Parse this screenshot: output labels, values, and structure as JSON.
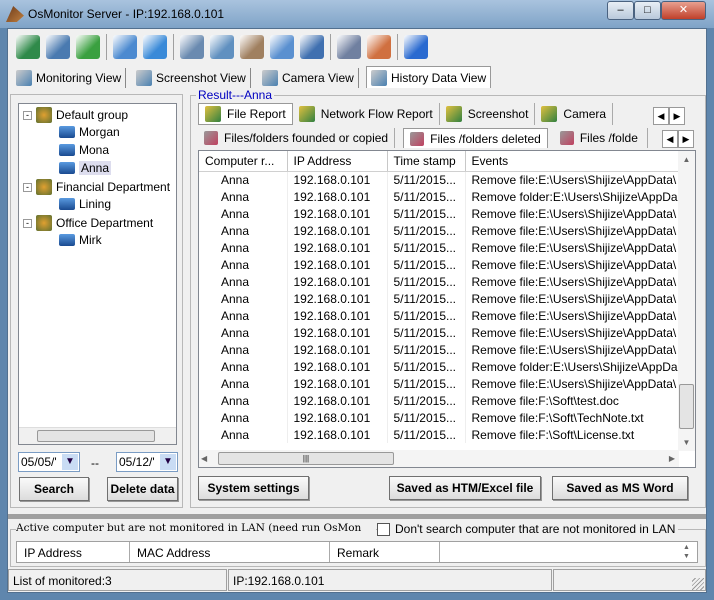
{
  "window": {
    "title": "OsMonitor Server -  IP:192.168.0.101",
    "minimize": "–",
    "maximize": "□",
    "close": "✕"
  },
  "toolbar": {
    "icons": [
      "windows-icon",
      "monitor-settings-icon",
      "users-icon",
      "app-control-icon",
      "usb-icon",
      "remote-desktop-icon",
      "mail-icon",
      "document-search-icon",
      "network-windows-icon",
      "disk-icon",
      "notebook-icon",
      "user-report-icon",
      "help-icon"
    ]
  },
  "main_tabs": [
    {
      "label": "Monitoring View"
    },
    {
      "label": "Screenshot View"
    },
    {
      "label": "Camera View"
    },
    {
      "label": "History Data View",
      "active": true
    }
  ],
  "tree": {
    "groups": [
      {
        "label": "Default group",
        "members": [
          "Morgan",
          "Mona",
          "Anna"
        ]
      },
      {
        "label": "Financial Department",
        "members": [
          "Lining"
        ]
      },
      {
        "label": "Office Department",
        "members": [
          "Mirk"
        ]
      }
    ],
    "selected": "Anna"
  },
  "date_range": {
    "from": "05/05/'",
    "separator": "--",
    "to": "05/12/'"
  },
  "left_buttons": {
    "search": "Search",
    "delete": "Delete data"
  },
  "result": {
    "legend": "Result---Anna",
    "report_tabs": [
      {
        "label": "File Report",
        "active": true
      },
      {
        "label": "Network Flow Report"
      },
      {
        "label": "Screenshot"
      },
      {
        "label": "Camera"
      }
    ],
    "sub_tabs": [
      {
        "label": "Files/folders founded or copied"
      },
      {
        "label": "Files /folders deleted",
        "active": true
      },
      {
        "label": "Files /folde"
      }
    ],
    "columns": [
      "Computer r...",
      "IP Address",
      "Time stamp",
      "Events"
    ],
    "rows": [
      [
        "Anna",
        "192.168.0.101",
        "5/11/2015...",
        "Remove file:E:\\Users\\Shijize\\AppData\\"
      ],
      [
        "Anna",
        "192.168.0.101",
        "5/11/2015...",
        "Remove folder:E:\\Users\\Shijize\\AppDa"
      ],
      [
        "Anna",
        "192.168.0.101",
        "5/11/2015...",
        "Remove file:E:\\Users\\Shijize\\AppData\\"
      ],
      [
        "Anna",
        "192.168.0.101",
        "5/11/2015...",
        "Remove file:E:\\Users\\Shijize\\AppData\\"
      ],
      [
        "Anna",
        "192.168.0.101",
        "5/11/2015...",
        "Remove file:E:\\Users\\Shijize\\AppData\\"
      ],
      [
        "Anna",
        "192.168.0.101",
        "5/11/2015...",
        "Remove file:E:\\Users\\Shijize\\AppData\\"
      ],
      [
        "Anna",
        "192.168.0.101",
        "5/11/2015...",
        "Remove file:E:\\Users\\Shijize\\AppData\\"
      ],
      [
        "Anna",
        "192.168.0.101",
        "5/11/2015...",
        "Remove file:E:\\Users\\Shijize\\AppData\\"
      ],
      [
        "Anna",
        "192.168.0.101",
        "5/11/2015...",
        "Remove file:E:\\Users\\Shijize\\AppData\\"
      ],
      [
        "Anna",
        "192.168.0.101",
        "5/11/2015...",
        "Remove file:E:\\Users\\Shijize\\AppData\\"
      ],
      [
        "Anna",
        "192.168.0.101",
        "5/11/2015...",
        "Remove file:E:\\Users\\Shijize\\AppData\\"
      ],
      [
        "Anna",
        "192.168.0.101",
        "5/11/2015...",
        "Remove folder:E:\\Users\\Shijize\\AppDa"
      ],
      [
        "Anna",
        "192.168.0.101",
        "5/11/2015...",
        "Remove file:E:\\Users\\Shijize\\AppData\\"
      ],
      [
        "Anna",
        "192.168.0.101",
        "5/11/2015...",
        "Remove file:F:\\Soft\\test.doc"
      ],
      [
        "Anna",
        "192.168.0.101",
        "5/11/2015...",
        "Remove file:F:\\Soft\\TechNote.txt"
      ],
      [
        "Anna",
        "192.168.0.101",
        "5/11/2015...",
        "Remove file:F:\\Soft\\License.txt"
      ]
    ]
  },
  "right_buttons": {
    "settings": "System settings",
    "save_htm": "Saved as HTM/Excel file",
    "save_word": "Saved as MS Word"
  },
  "lan": {
    "legend": "Active computer but are not monitored in LAN (need run OsMon",
    "checkbox_label": "Don't search computer that are not monitored in LAN",
    "checked": false,
    "columns": [
      "IP Address",
      "MAC Address",
      "Remark"
    ]
  },
  "statusbar": {
    "monitored": "List of monitored:3",
    "ip": "IP:192.168.0.101"
  },
  "colors": {
    "accent_legend": "#0000c0",
    "frame": "#5f86ad",
    "client": "#f0f0f0"
  }
}
